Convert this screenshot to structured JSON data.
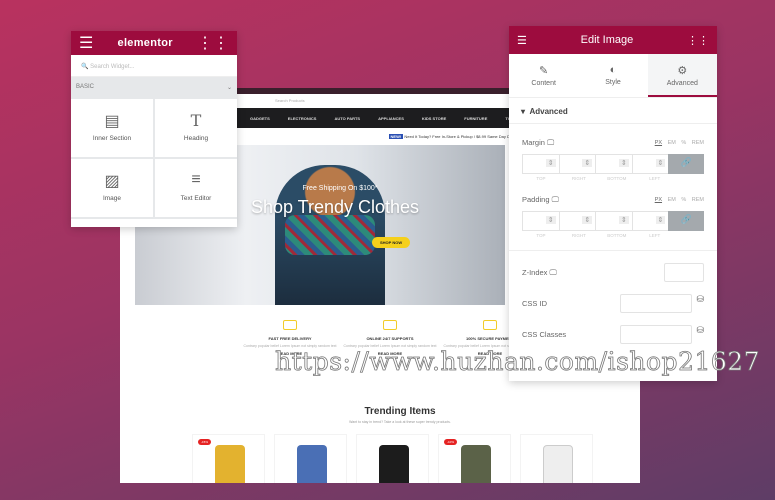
{
  "site": {
    "search_placeholder": "Search Products",
    "nav": [
      "GADGETS",
      "ELECTRONICS",
      "AUTO PARTS",
      "APPLIANCES",
      "KIDS STORE",
      "FURNITURE",
      "TOOL"
    ],
    "promo_badge": "NEW!",
    "promo_text": "Need It Today? Free In-Store & Pickup / $8.99 Same Day Delivery",
    "hero": {
      "subtitle": "Free Shipping On $100*",
      "title": "Shop Trendy Clothes",
      "button": "SHOP NOW"
    },
    "features": [
      {
        "title": "FAST FREE DELIVERY",
        "desc": "Contrary popular belief Lorem Ipsum not simply random text",
        "link": "READ MORE"
      },
      {
        "title": "ONLINE 24/7 SUPPORTS",
        "desc": "Contrary popular belief Lorem Ipsum not simply random text",
        "link": "READ MORE"
      },
      {
        "title": "100% SECURE PAYMENT",
        "desc": "Contrary popular belief Lorem Ipsum not simply random text",
        "link": "READ MORE"
      }
    ],
    "trending": {
      "title": "Trending Items",
      "subtitle": "Want to stay in trend? Take a look at these super trendy products."
    },
    "products": [
      {
        "name": "sweater",
        "badge": "-15%",
        "color": "#e3b22f"
      },
      {
        "name": "tablet",
        "badge": "",
        "color": "#4a6fb5"
      },
      {
        "name": "air-fryer",
        "badge": "",
        "color": "#1c1c1c"
      },
      {
        "name": "backpack",
        "badge": "-10%",
        "color": "#5b6248"
      },
      {
        "name": "game-controller",
        "badge": "",
        "color": "#eeeeee"
      }
    ]
  },
  "left_panel": {
    "logo": "elementor",
    "search_placeholder": "Search Widget...",
    "category": "BASIC",
    "widgets": [
      {
        "label": "Inner Section",
        "icon": "columns-icon"
      },
      {
        "label": "Heading",
        "icon": "heading-icon"
      },
      {
        "label": "Image",
        "icon": "image-icon"
      },
      {
        "label": "Text Editor",
        "icon": "text-editor-icon"
      }
    ]
  },
  "right_panel": {
    "title": "Edit Image",
    "tabs": [
      {
        "label": "Content",
        "icon": "pencil-icon"
      },
      {
        "label": "Style",
        "icon": "contrast-icon"
      },
      {
        "label": "Advanced",
        "icon": "gear-icon",
        "active": true
      }
    ],
    "section": "Advanced",
    "margin_label": "Margin",
    "padding_label": "Padding",
    "units": [
      "PX",
      "EM",
      "%",
      "REM"
    ],
    "dims": [
      "TOP",
      "RIGHT",
      "BOTTOM",
      "LEFT"
    ],
    "zindex_label": "Z-Index",
    "cssid_label": "CSS ID",
    "cssclasses_label": "CSS Classes"
  },
  "accent": "#9d0c3e",
  "watermark": "https://www.huzhan.com/ishop21627"
}
